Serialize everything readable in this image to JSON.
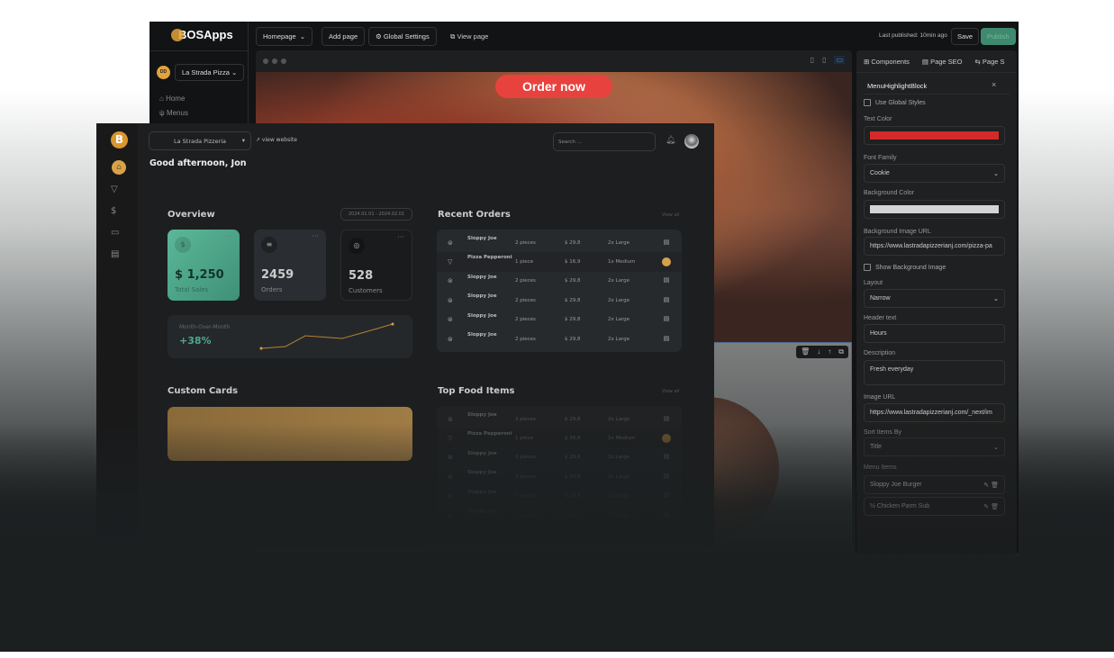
{
  "editor": {
    "brand": "BOSApps",
    "page_select": "Homepage",
    "add_page": "Add page",
    "global_settings": "Global Settings",
    "view_page": "View page",
    "last_published": "Last published: 10min ago",
    "save": "Save",
    "publish": "Publish",
    "restaurant_avatar": "DD",
    "restaurant_select": "La Strada Pizza",
    "nav": [
      {
        "label": "Home",
        "icon": "home-icon"
      },
      {
        "label": "Menus",
        "icon": "utensils-icon"
      }
    ],
    "preview": {
      "cta": "Order now"
    },
    "panel": {
      "tabs": [
        "Components",
        "Page SEO",
        "Page S"
      ],
      "block_title": "MenuHighlightBlock",
      "use_global_styles": "Use Global Styles",
      "text_color_label": "Text Color",
      "text_color": "#d42a2a",
      "font_family_label": "Font Family",
      "font_family": "Cookie",
      "bg_color_label": "Background Color",
      "bg_color": "#d4d4d4",
      "bg_image_label": "Background Image URL",
      "bg_image": "https://www.lastradapizzerianj.com/pizza-pa",
      "show_bg_image": "Show Background Image",
      "layout_label": "Layout",
      "layout": "Narrow",
      "header_label": "Header text",
      "header": "Hours",
      "description_label": "Description",
      "description": "Fresh everyday",
      "image_url_label": "Image URL",
      "image_url": "https://www.lastradapizzerianj.com/_next/im",
      "sort_label": "Sort Items By",
      "sort": "Title",
      "menu_items_label": "Menu Items",
      "menu_items": [
        "Sloppy Joe Burger",
        "½ Chicken Parm Sub"
      ]
    }
  },
  "dashboard": {
    "restaurant_select": "La Strada Pizzeria",
    "view_website": "↗ view website",
    "search_placeholder": "Search ...",
    "greeting": "Good afternoon, Jon",
    "overview": "Overview",
    "date_range": "2024.01.01 - 2024.02.01",
    "cards": [
      {
        "value": "$ 1,250",
        "label": "Total Sales"
      },
      {
        "value": "2459",
        "label": "Orders"
      },
      {
        "value": "528",
        "label": "Customers"
      }
    ],
    "mom_label": "Month-Over-Month",
    "mom_value": "+38%",
    "custom_cards": "Custom Cards",
    "recent_orders": "Recent Orders",
    "top_food": "Top Food Items",
    "view_all": "View all",
    "orders": [
      {
        "name": "Sloppy Joe",
        "qty": "2 pieces",
        "price": "$ 29,8",
        "size": "2x Large"
      },
      {
        "name": "Pizza Pepperoni",
        "qty": "1 piece",
        "price": "$ 16,9",
        "size": "1x Medium"
      },
      {
        "name": "Sloppy Joe",
        "qty": "2 pieces",
        "price": "$ 29,8",
        "size": "2x Large"
      },
      {
        "name": "Sloppy Joe",
        "qty": "2 pieces",
        "price": "$ 29,8",
        "size": "2x Large"
      },
      {
        "name": "Sloppy Joe",
        "qty": "2 pieces",
        "price": "$ 29,8",
        "size": "2x Large"
      },
      {
        "name": "Sloppy Joe",
        "qty": "2 pieces",
        "price": "$ 29,8",
        "size": "2x Large"
      }
    ],
    "accent": "#d6a24a",
    "green": "#4fa98a"
  }
}
